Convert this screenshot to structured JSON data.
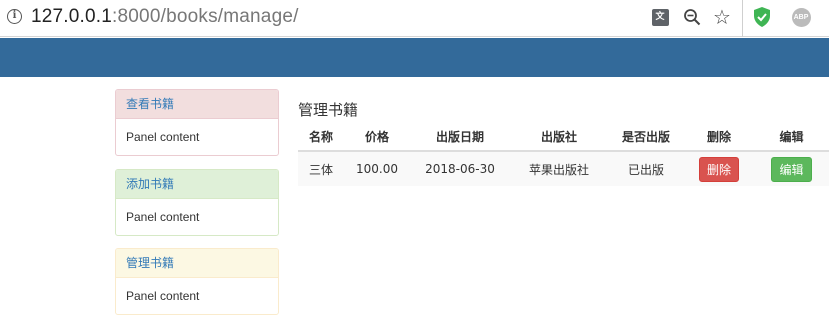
{
  "browser": {
    "url_host": "127.0.0.1",
    "url_rest": ":8000/books/manage/",
    "abp_label": "ABP",
    "translate_label": "文"
  },
  "sidebar": {
    "panels": [
      {
        "title": "查看书籍",
        "body": "Panel content"
      },
      {
        "title": "添加书籍",
        "body": "Panel content"
      },
      {
        "title": "管理书籍",
        "body": "Panel content"
      }
    ]
  },
  "main": {
    "title": "管理书籍",
    "columns": [
      "名称",
      "价格",
      "出版日期",
      "出版社",
      "是否出版",
      "删除",
      "编辑"
    ],
    "rows": [
      {
        "name": "三体",
        "price": "100.00",
        "date": "2018-06-30",
        "publisher": "苹果出版社",
        "published": "已出版",
        "delete_label": "删除",
        "edit_label": "编辑"
      }
    ]
  },
  "colors": {
    "navbar": "#336a9a",
    "danger": "#d9534f",
    "success": "#5cb85c",
    "link": "#337ab7"
  }
}
